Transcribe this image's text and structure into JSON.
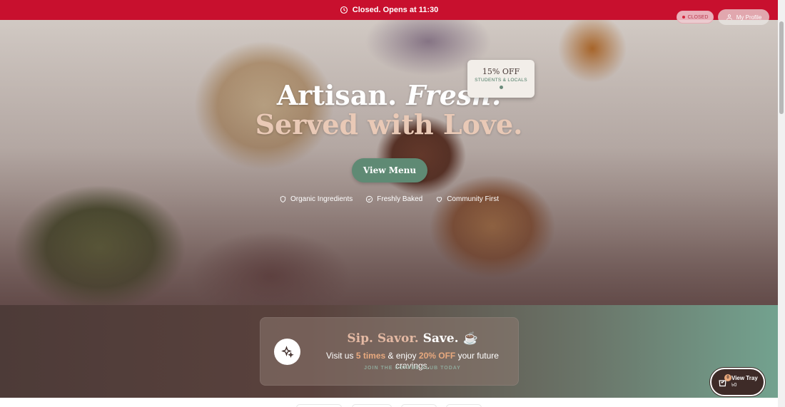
{
  "announcement": {
    "text": "Closed. Opens at 11:30",
    "icon": "clock-icon",
    "color": "#c8102e"
  },
  "header": {
    "status_label": "CLOSED",
    "profile_label": "My Profile"
  },
  "promo": {
    "percent": "15% OFF",
    "audience": "STUDENTS & LOCALS"
  },
  "hero": {
    "title_plain": "Artisan.",
    "title_italic": "Fresh.",
    "subtitle": "Served with Love.",
    "cta_label": "View Menu",
    "features": [
      {
        "label": "Organic Ingredients",
        "icon": "shield-icon"
      },
      {
        "label": "Freshly Baked",
        "icon": "check-circle-icon"
      },
      {
        "label": "Community First",
        "icon": "heart-icon"
      }
    ]
  },
  "club": {
    "title_a": "Sip. Savor.",
    "title_b": "Save.",
    "emoji": "☕",
    "line_pre": "Visit us",
    "line_visits": "5 times",
    "line_mid": "& enjoy",
    "line_discount": "20% OFF",
    "line_post": "your future cravings.",
    "cta": "JOIN THE COFFEE CLUB TODAY",
    "icon": "sparkles-icon"
  },
  "tray": {
    "label": "View Tray",
    "amount": "৳0",
    "count": "0"
  },
  "colors": {
    "accent_green": "#5f8a74",
    "brand_brown": "#3e2b28",
    "alert_red": "#c8102e"
  }
}
